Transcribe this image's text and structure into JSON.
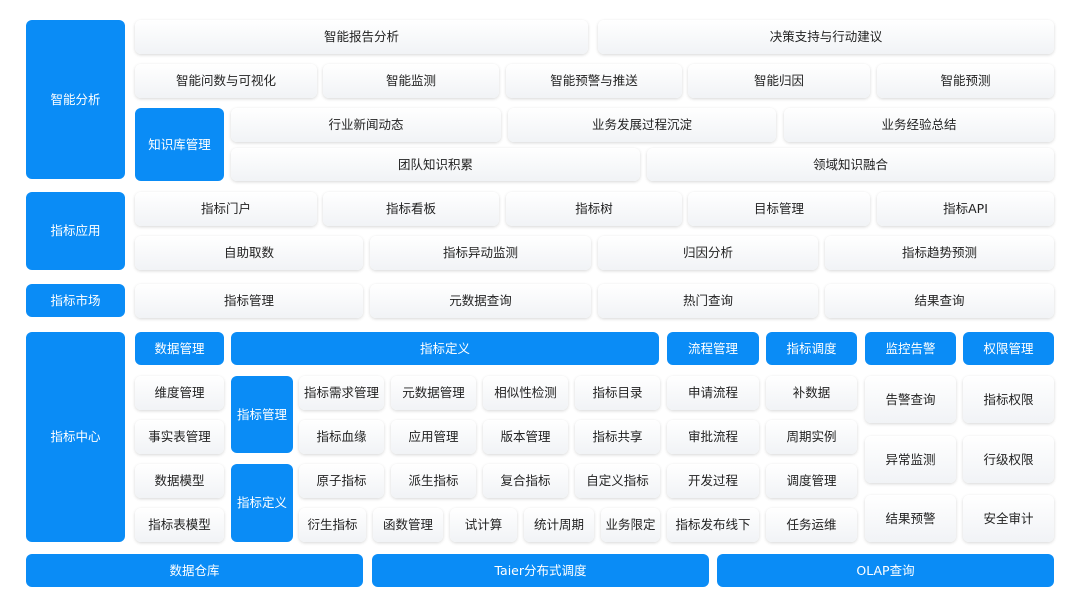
{
  "analysis": {
    "label": "智能分析",
    "row1": [
      "智能报告分析",
      "决策支持与行动建议"
    ],
    "row2": [
      "智能问数与可视化",
      "智能监测",
      "智能预警与推送",
      "智能归因",
      "智能预测"
    ],
    "kb": {
      "label": "知识库管理",
      "row1": [
        "行业新闻动态",
        "业务发展过程沉淀",
        "业务经验总结"
      ],
      "row2": [
        "团队知识积累",
        "领域知识融合"
      ]
    }
  },
  "application": {
    "label": "指标应用",
    "row1": [
      "指标门户",
      "指标看板",
      "指标树",
      "目标管理",
      "指标API"
    ],
    "row2": [
      "自助取数",
      "指标异动监测",
      "归因分析",
      "指标趋势预测"
    ]
  },
  "market": {
    "label": "指标市场",
    "items": [
      "指标管理",
      "元数据查询",
      "热门查询",
      "结果查询"
    ]
  },
  "center": {
    "label": "指标中心",
    "data_mgmt": {
      "header": "数据管理",
      "items": [
        "维度管理",
        "事实表管理",
        "数据模型",
        "指标表模型"
      ]
    },
    "metric_def": {
      "header": "指标定义",
      "mgmt_label": "指标管理",
      "mgmt_rows": [
        [
          "指标需求管理",
          "元数据管理",
          "相似性检测",
          "指标目录"
        ],
        [
          "指标血缘",
          "应用管理",
          "版本管理",
          "指标共享"
        ]
      ],
      "def_label": "指标定义",
      "def_rows": [
        [
          "原子指标",
          "派生指标",
          "复合指标",
          "自定义指标"
        ],
        [
          "衍生指标",
          "函数管理",
          "试计算",
          "统计周期",
          "业务限定"
        ]
      ]
    },
    "process": {
      "header": "流程管理",
      "items": [
        "申请流程",
        "审批流程",
        "开发过程",
        "指标发布线下"
      ]
    },
    "schedule": {
      "header": "指标调度",
      "items": [
        "补数据",
        "周期实例",
        "调度管理",
        "任务运维"
      ]
    },
    "monitor": {
      "header": "监控告警",
      "items": [
        "告警查询",
        "异常监测",
        "结果预警"
      ]
    },
    "permission": {
      "header": "权限管理",
      "items": [
        "指标权限",
        "行级权限",
        "安全审计"
      ]
    }
  },
  "foundation": [
    "数据仓库",
    "Taier分布式调度",
    "OLAP查询"
  ],
  "colors": {
    "accent": "#0a8cf6",
    "card": "#f5f6f8",
    "text": "#222222"
  }
}
